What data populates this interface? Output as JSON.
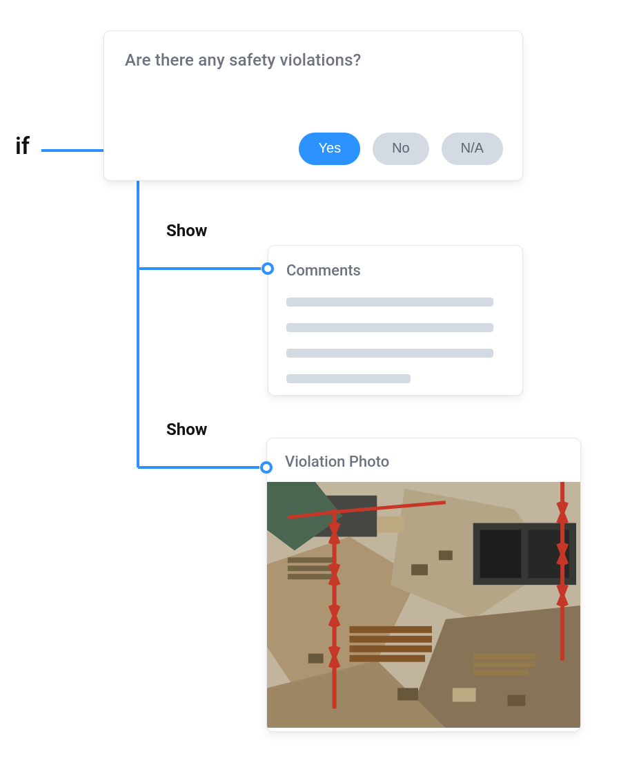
{
  "logic": {
    "if_label": "if",
    "show_label_1": "Show",
    "show_label_2": "Show"
  },
  "question": {
    "text": "Are there any safety violations?",
    "answers": {
      "yes": "Yes",
      "no": "No",
      "na": "N/A"
    },
    "selected": "yes"
  },
  "comments": {
    "title": "Comments"
  },
  "photo": {
    "title": "Violation Photo"
  },
  "colors": {
    "accent": "#2c92ff",
    "muted_pill": "#d4dae1",
    "text_muted": "#6b7280"
  }
}
